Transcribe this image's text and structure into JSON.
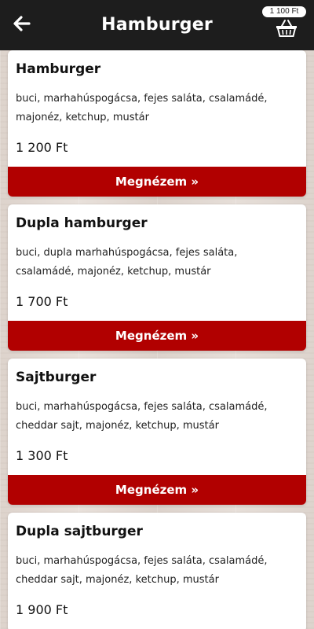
{
  "header": {
    "title": "Hamburger",
    "back_icon": "arrow-left-icon",
    "cart_icon": "basket-icon",
    "cart_total": "1 100 Ft",
    "background": "#1d1d1d"
  },
  "accent_color": "#b10000",
  "products": [
    {
      "name": "Hamburger",
      "description": "buci, marhahúspogácsa, fejes saláta, csalamádé, majonéz, ketchup, mustár",
      "price": "1 200 Ft",
      "button_label": "Megnézem »"
    },
    {
      "name": "Dupla hamburger",
      "description": "buci, dupla marhahúspogácsa, fejes saláta, csalamádé, majonéz, ketchup, mustár",
      "price": "1 700 Ft",
      "button_label": "Megnézem »"
    },
    {
      "name": "Sajtburger",
      "description": "buci, marhahúspogácsa, fejes saláta, csalamádé, cheddar sajt, majonéz, ketchup, mustár",
      "price": "1 300 Ft",
      "button_label": "Megnézem »"
    },
    {
      "name": "Dupla sajtburger",
      "description": "buci, marhahúspogácsa, fejes saláta, csalamádé, cheddar sajt, majonéz, ketchup, mustár",
      "price": "1 900 Ft",
      "button_label": ""
    }
  ]
}
